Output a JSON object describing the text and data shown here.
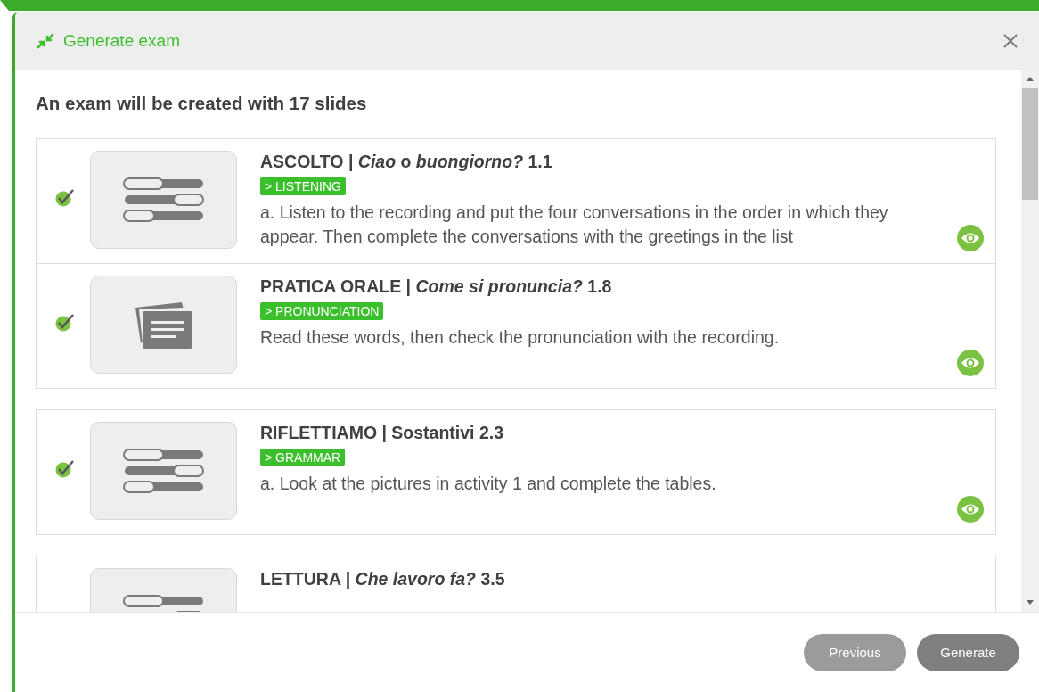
{
  "dialog": {
    "title": "Generate exam",
    "summary": "An exam will be created with 17 slides"
  },
  "groups": [
    {
      "slides": [
        {
          "kind": "sliders",
          "checked": true,
          "title": "ASCOLTO | *Ciao* o *buongiorno?* 1.1",
          "tag": "> LISTENING",
          "description": "a. Listen to the recording and put the four conversations in the order in which they appear. Then complete the conversations with the greetings in the list"
        },
        {
          "kind": "cards",
          "checked": true,
          "title": "PRATICA ORALE | *Come si pronuncia?* 1.8",
          "tag": "> PRONUNCIATION",
          "description": "Read these words, then check the pronunciation with the recording."
        }
      ]
    },
    {
      "slides": [
        {
          "kind": "sliders",
          "checked": true,
          "title": "RIFLETTIAMO | Sostantivi 2.3",
          "tag": "> GRAMMAR",
          "description": "a. Look at the pictures in activity 1 and complete the tables."
        }
      ]
    },
    {
      "slides": [
        {
          "kind": "sliders",
          "title": "LETTURA | *Che lavoro fa?* 3.5"
        }
      ]
    }
  ],
  "buttons": [
    {
      "label": "Previous",
      "kind": "secondary"
    },
    {
      "label": "Generate",
      "kind": "primary"
    }
  ]
}
